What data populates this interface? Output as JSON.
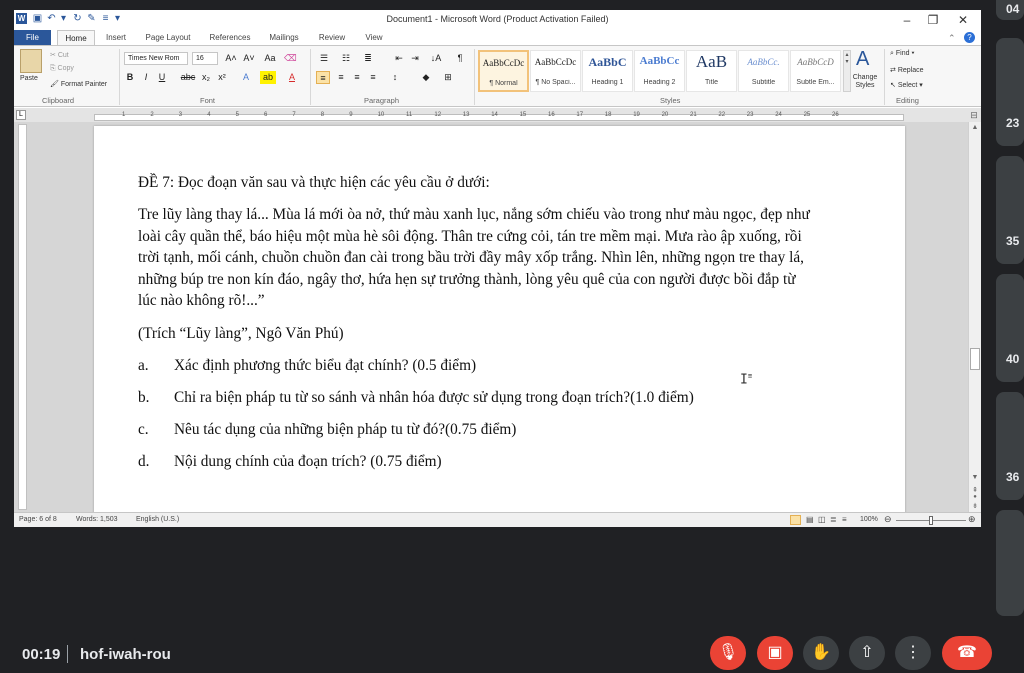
{
  "window": {
    "title": "Document1 - Microsoft Word (Product Activation Failed)",
    "minimize": "–",
    "restore": "❐",
    "close": "✕"
  },
  "tabs": [
    "File",
    "Home",
    "Insert",
    "Page Layout",
    "References",
    "Mailings",
    "Review",
    "View"
  ],
  "clipboard": {
    "paste": "Paste",
    "cut": "Cut",
    "copy": "Copy",
    "format_painter": "Format Painter",
    "label": "Clipboard"
  },
  "font": {
    "name": "Times New Rom",
    "size": "16",
    "label": "Font",
    "bold": "B",
    "italic": "I",
    "underline": "U",
    "strike": "abc",
    "sub": "x₂",
    "sup": "x²",
    "grow": "A˄",
    "shrink": "A˅",
    "case": "Aa",
    "highlight": "ab",
    "color": "A"
  },
  "paragraph": {
    "label": "Paragraph",
    "pilcrow": "¶",
    "sort": "↓A"
  },
  "styles": {
    "label": "Styles",
    "items": [
      {
        "preview": "AaBbCcDc",
        "name": "¶ Normal"
      },
      {
        "preview": "AaBbCcDc",
        "name": "¶ No Spaci..."
      },
      {
        "preview": "AaBbC",
        "name": "Heading 1"
      },
      {
        "preview": "AaBbCc",
        "name": "Heading 2"
      },
      {
        "preview": "AaB",
        "name": "Title"
      },
      {
        "preview": "AaBbCc.",
        "name": "Subtitle"
      },
      {
        "preview": "AaBbCcD",
        "name": "Subtle Em..."
      }
    ],
    "change": "Change Styles"
  },
  "editing": {
    "label": "Editing",
    "find": "Find",
    "replace": "Replace",
    "select": "Select"
  },
  "document": {
    "heading": "ĐỀ 7: Đọc đoạn văn sau và thực hiện các yêu cầu ở dưới:",
    "lines": [
      "Tre lũy làng thay lá... Mùa lá mới òa nở, thứ màu xanh lục, nắng sớm chiếu vào trong như màu ngọc, đẹp như",
      "loài cây quần thể, báo hiệu một mùa hè sôi động. Thân tre cứng cỏi, tán tre mềm mại. Mưa rào ập xuống, rồi",
      "trời tạnh, mối cánh, chuồn chuồn đan cài trong bầu trời đầy mây xốp trắng. Nhìn lên, những ngọn tre thay lá,",
      "những búp tre non kín đáo, ngây thơ, hứa hẹn sự trưởng thành, lòng yêu quê của con người được bồi đắp từ",
      "lúc nào không rõ!...”"
    ],
    "source": "(Trích “Lũy làng”, Ngô Văn Phú)",
    "questions": [
      {
        "letter": "a.",
        "text": "Xác định phương thức biểu đạt chính? (0.5 điểm)"
      },
      {
        "letter": "b.",
        "text": "Chỉ ra biện pháp tu từ so sánh và nhân hóa được sử dụng trong đoạn trích?(1.0 điểm)"
      },
      {
        "letter": "c.",
        "text": "Nêu tác dụng của những biện pháp tu từ đó?(0.75 điểm)"
      },
      {
        "letter": "d.",
        "text": "Nội dung chính của đoạn trích? (0.75 điểm)"
      }
    ]
  },
  "status": {
    "page": "Page: 6 of 8",
    "words": "Words: 1,503",
    "lang": "English (U.S.)",
    "zoom": "100%"
  },
  "ruler_numbers": [
    "1",
    "2",
    "3",
    "4",
    "5",
    "6",
    "7",
    "8",
    "9",
    "10",
    "11",
    "12",
    "13",
    "14",
    "15",
    "16",
    "17",
    "18",
    "19",
    "20",
    "21",
    "22",
    "23",
    "24",
    "25",
    "26"
  ],
  "meet": {
    "time": "00:19",
    "code": "hof-iwah-rou"
  },
  "side_tiles": [
    "04",
    "23",
    "35",
    "40",
    "36"
  ]
}
